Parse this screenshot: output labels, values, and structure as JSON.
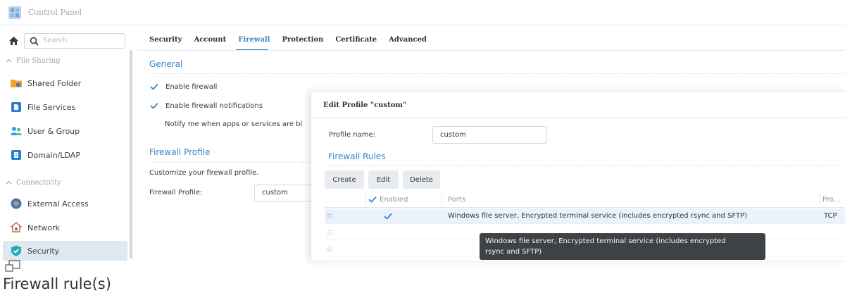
{
  "window": {
    "title": "Control Panel"
  },
  "search": {
    "placeholder": "Search"
  },
  "sidebar": {
    "sections": [
      {
        "label": "File Sharing",
        "items": [
          {
            "label": "Shared Folder",
            "icon": "shared-folder-icon",
            "active": false
          },
          {
            "label": "File Services",
            "icon": "file-services-icon",
            "active": false
          },
          {
            "label": "User & Group",
            "icon": "user-group-icon",
            "active": false
          },
          {
            "label": "Domain/LDAP",
            "icon": "domain-ldap-icon",
            "active": false
          }
        ]
      },
      {
        "label": "Connectivity",
        "items": [
          {
            "label": "External Access",
            "icon": "external-access-icon",
            "active": false
          },
          {
            "label": "Network",
            "icon": "network-icon",
            "active": false
          },
          {
            "label": "Security",
            "icon": "security-icon",
            "active": true
          }
        ]
      }
    ]
  },
  "tabs": [
    {
      "label": "Security",
      "active": false
    },
    {
      "label": "Account",
      "active": false
    },
    {
      "label": "Firewall",
      "active": true
    },
    {
      "label": "Protection",
      "active": false
    },
    {
      "label": "Certificate",
      "active": false
    },
    {
      "label": "Advanced",
      "active": false
    }
  ],
  "general": {
    "title": "General",
    "enable_firewall": "Enable firewall",
    "enable_notifications": "Enable firewall notifications",
    "notify_text": "Notify me when apps or services are bl"
  },
  "firewall_profile": {
    "title": "Firewall Profile",
    "description": "Customize your firewall profile.",
    "label": "Firewall Profile:",
    "value": "custom"
  },
  "dialog": {
    "title": "Edit Profile \"custom\"",
    "profile_name_label": "Profile name:",
    "profile_name_value": "custom",
    "rules_title": "Firewall Rules",
    "buttons": {
      "create": "Create",
      "edit": "Edit",
      "delete": "Delete"
    },
    "columns": {
      "enabled": "Enabled",
      "ports": "Ports",
      "protocol": "Pro..."
    },
    "rows": [
      {
        "enabled": true,
        "ports": "Windows file server, Encrypted terminal service (includes encrypted rsync and SFTP)",
        "protocol": "TCP"
      },
      {
        "enabled": false,
        "ports": "",
        "protocol": ""
      },
      {
        "enabled": false,
        "ports": "",
        "protocol": ""
      }
    ],
    "tooltip": {
      "line1": "Windows file server, Encrypted terminal service (includes encrypted",
      "line2": "rsync and SFTP)"
    }
  },
  "caption": "Firewall rule(s)",
  "colors": {
    "accent": "#3b83c8",
    "active_nav_bg": "#dfe7ef",
    "selected_row_bg": "#eaf2fb",
    "tooltip_bg": "#3d4247"
  }
}
